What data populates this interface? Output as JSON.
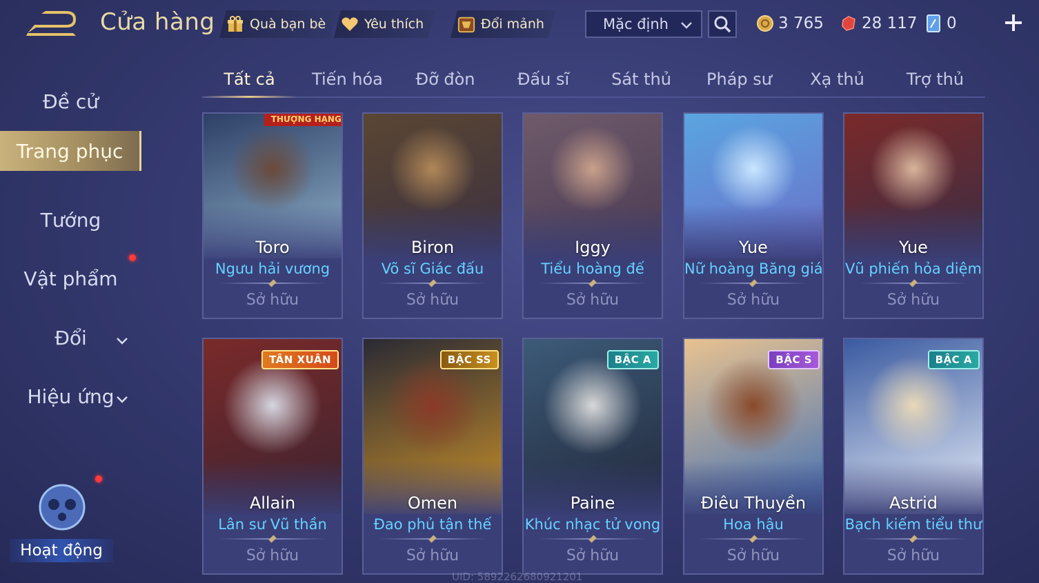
{
  "header": {
    "title": "Cửa hàng",
    "gift_label": "Quà bạn bè",
    "favorite_label": "Yêu thích",
    "exchange_label": "Đổi mảnh",
    "sort_value": "Mặc định",
    "gold": "3 765",
    "vouchers": "28 117",
    "tokens": "0"
  },
  "sidebar": {
    "items": [
      {
        "label": "Đề cử"
      },
      {
        "label": "Trang phục"
      },
      {
        "label": "Tướng"
      },
      {
        "label": "Vật phẩm"
      },
      {
        "label": "Đổi"
      },
      {
        "label": "Hiệu ứng"
      }
    ],
    "activity_label": "Hoạt động"
  },
  "tabs": [
    "Tất cả",
    "Tiến hóa",
    "Đỡ đòn",
    "Đấu sĩ",
    "Sát thủ",
    "Pháp sư",
    "Xạ thủ",
    "Trợ thủ"
  ],
  "cards": [
    {
      "hero": "Toro",
      "skin": "Ngưu hải vương",
      "status": "Sở hữu",
      "ribbon": "THƯỢNG HẠNG",
      "colors": [
        "#2d3f66",
        "#6b4a3a",
        "#8fb1c9"
      ]
    },
    {
      "hero": "Biron",
      "skin": "Võ sĩ Giác đấu",
      "status": "Sở hữu",
      "colors": [
        "#5a4633",
        "#b08757",
        "#3b3040"
      ]
    },
    {
      "hero": "Iggy",
      "skin": "Tiểu hoàng đế",
      "status": "Sở hữu",
      "colors": [
        "#6e5a6a",
        "#c9a08a",
        "#4a3a52"
      ]
    },
    {
      "hero": "Yue",
      "skin": "Nữ hoàng Băng giá",
      "status": "Sở hữu",
      "colors": [
        "#5aa5e0",
        "#c9e6ff",
        "#6b6ec9"
      ]
    },
    {
      "hero": "Yue",
      "skin": "Vũ phiến hỏa diệm",
      "status": "Sở hữu",
      "colors": [
        "#7a2a2a",
        "#d9b49c",
        "#3a2d44"
      ]
    },
    {
      "hero": "Allain",
      "skin": "Lân sư Vũ thần",
      "status": "Sở hữu",
      "badge": "TÂN XUÂN",
      "colors": [
        "#7a2a2a",
        "#d6d6e0",
        "#3b2330"
      ]
    },
    {
      "hero": "Omen",
      "skin": "Đao phủ tận thế",
      "status": "Sở hữu",
      "badge": "BẬC SS",
      "colors": [
        "#2a2a34",
        "#8a3a28",
        "#c9902a"
      ]
    },
    {
      "hero": "Paine",
      "skin": "Khúc nhạc tử vong",
      "status": "Sở hữu",
      "badge": "BẬC A",
      "colors": [
        "#3c5a78",
        "#d8d8d8",
        "#22283a"
      ]
    },
    {
      "hero": "Điêu Thuyền",
      "skin": "Hoa hậu",
      "status": "Sở hữu",
      "badge": "BẬC S",
      "colors": [
        "#e8c290",
        "#8a4a2a",
        "#3f6fb6"
      ]
    },
    {
      "hero": "Astrid",
      "skin": "Bạch kiếm tiểu thư",
      "status": "Sở hữu",
      "badge": "BẬC A",
      "colors": [
        "#3a5aa0",
        "#e8d8b8",
        "#e8eef8"
      ]
    }
  ],
  "uid": "UID: 5892262680921201"
}
